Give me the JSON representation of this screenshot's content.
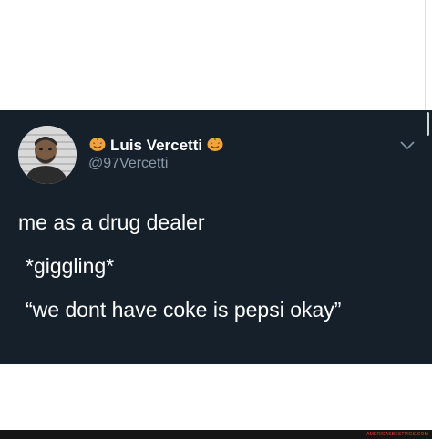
{
  "tweet": {
    "author_name": "Luis Vercetti",
    "handle": "@97Vercetti",
    "name_emoji": "pumpkin-emoji",
    "lines": [
      "me as a drug dealer",
      "*giggling*",
      "“we dont have coke is pepsi okay”"
    ]
  },
  "watermark": "AMERICASBESTPICS.COM",
  "colors": {
    "card_background": "#15202b",
    "name": "#ffffff",
    "handle": "#8899a6",
    "pumpkin": "#f0a43a",
    "footer": "#151515",
    "watermark": "#e5492f"
  },
  "icons": [
    "pumpkin-icon",
    "chevron-down-icon",
    "avatar"
  ]
}
